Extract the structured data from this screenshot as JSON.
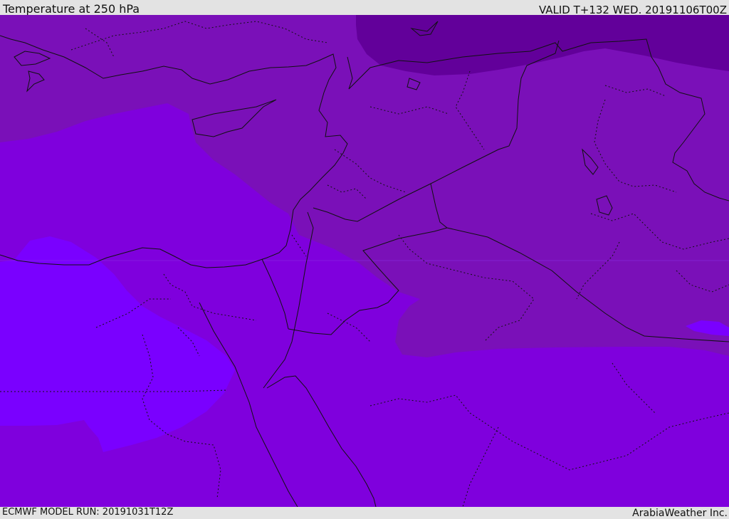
{
  "header": {
    "title": "Temperature at 250 hPa",
    "valid": "VALID T+132 WED. 20191106T00Z"
  },
  "footer": {
    "model_run": "ECMWF MODEL RUN: 20191031T12Z",
    "credit": "ArabiaWeather Inc."
  },
  "map": {
    "colors": {
      "base": "#7f00dd",
      "warm_band": "#7a10b8",
      "coldest": "#62009a",
      "cold_pool": "#7a00ff",
      "border": "#111111"
    }
  }
}
